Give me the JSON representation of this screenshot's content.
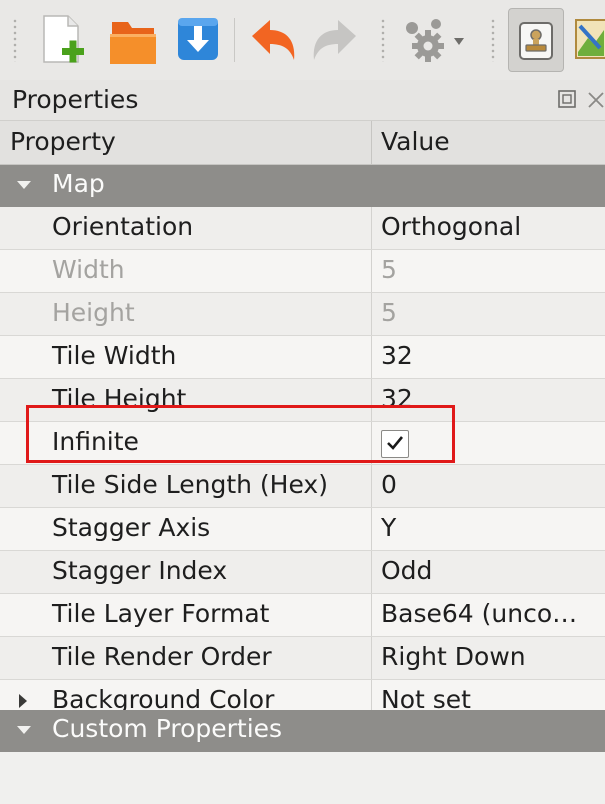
{
  "toolbar": {
    "buttons": [
      {
        "name": "new-map-button",
        "icon": "new-file-icon"
      },
      {
        "name": "open-button",
        "icon": "folder-icon"
      },
      {
        "name": "save-button",
        "icon": "save-download-icon"
      },
      {
        "name": "undo-button",
        "icon": "undo-icon"
      },
      {
        "name": "redo-button",
        "icon": "redo-icon"
      },
      {
        "name": "commands-button",
        "icon": "gears-icon"
      },
      {
        "name": "stamp-tool-button",
        "icon": "stamp-icon"
      },
      {
        "name": "terrain-tool-button",
        "icon": "terrain-brush-icon"
      }
    ],
    "colors": {
      "orange": "#f47a1f",
      "green": "#4aa11b",
      "blue": "#2e86d9"
    }
  },
  "dock": {
    "title": "Properties"
  },
  "table": {
    "header": {
      "property": "Property",
      "value": "Value"
    },
    "groups": {
      "map": "Map",
      "custom": "Custom Properties"
    },
    "rows": [
      {
        "name": "Orientation",
        "value": "Orthogonal"
      },
      {
        "name": "Width",
        "value": "5",
        "disabled": true
      },
      {
        "name": "Height",
        "value": "5",
        "disabled": true
      },
      {
        "name": "Tile Width",
        "value": "32"
      },
      {
        "name": "Tile Height",
        "value": "32"
      },
      {
        "name": "Infinite",
        "value": "",
        "checked": true
      },
      {
        "name": "Tile Side Length (Hex)",
        "value": "0"
      },
      {
        "name": "Stagger Axis",
        "value": "Y"
      },
      {
        "name": "Stagger Index",
        "value": "Odd"
      },
      {
        "name": "Tile Layer Format",
        "value": "Base64 (unco…"
      },
      {
        "name": "Tile Render Order",
        "value": "Right Down"
      },
      {
        "name": "Background Color",
        "value": "Not set"
      }
    ]
  },
  "annotation": {
    "highlight_color": "#e01919"
  }
}
